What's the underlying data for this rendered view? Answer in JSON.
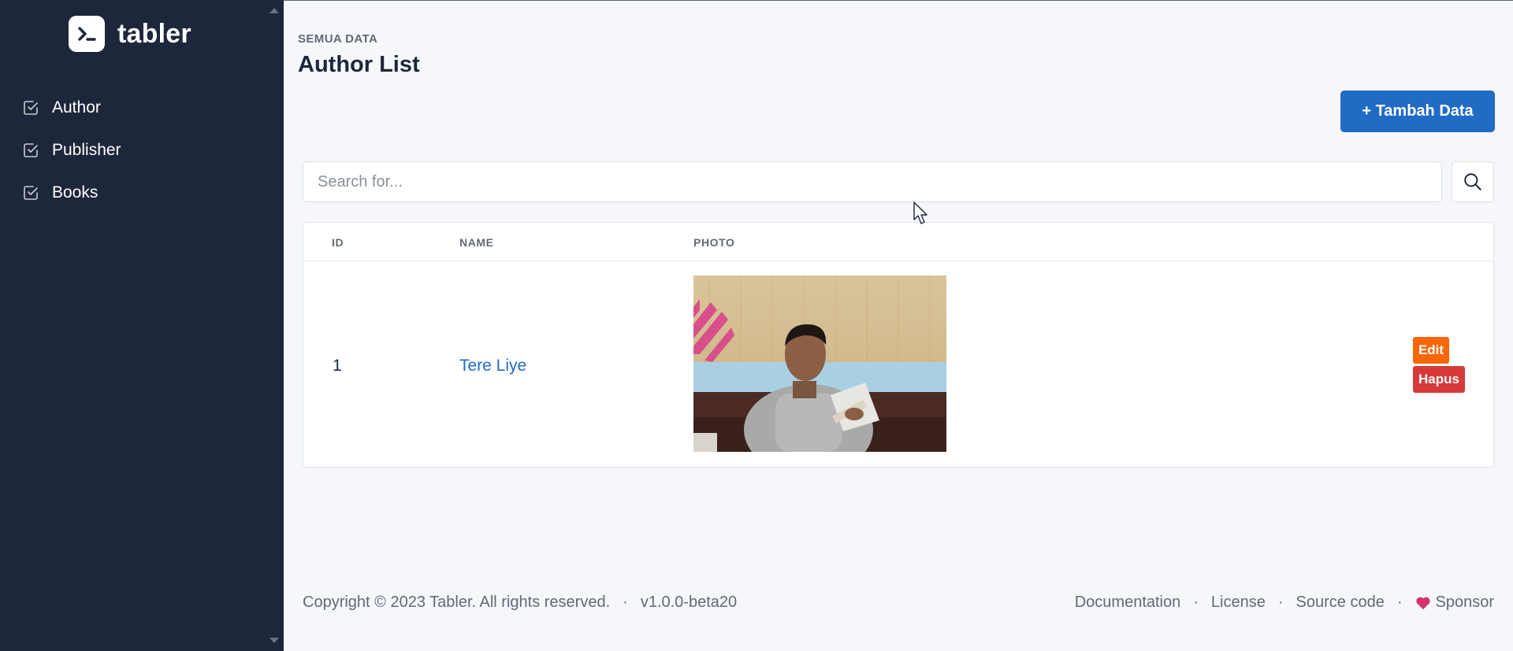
{
  "brand": {
    "name": "tabler"
  },
  "sidebar": {
    "items": [
      {
        "label": "Author",
        "icon": "checkbox-icon"
      },
      {
        "label": "Publisher",
        "icon": "checkbox-icon"
      },
      {
        "label": "Books",
        "icon": "checkbox-icon"
      }
    ]
  },
  "header": {
    "pretitle": "SEMUA DATA",
    "title": "Author List",
    "add_button": "+ Tambah Data"
  },
  "search": {
    "placeholder": "Search for...",
    "value": ""
  },
  "table": {
    "columns": [
      "ID",
      "NAME",
      "PHOTO"
    ],
    "rows": [
      {
        "id": "1",
        "name": "Tere Liye",
        "photo": "author-photo",
        "edit_label": "Edit",
        "delete_label": "Hapus"
      }
    ]
  },
  "footer": {
    "copyright": "Copyright © 2023 Tabler. All rights reserved.",
    "version": "v1.0.0-beta20",
    "links": [
      "Documentation",
      "License",
      "Source code",
      "Sponsor"
    ]
  },
  "colors": {
    "sidebar_bg": "#1d273b",
    "primary": "#206bc4",
    "edit": "#f76707",
    "delete": "#d63939",
    "sponsor_heart": "#d6336c"
  }
}
